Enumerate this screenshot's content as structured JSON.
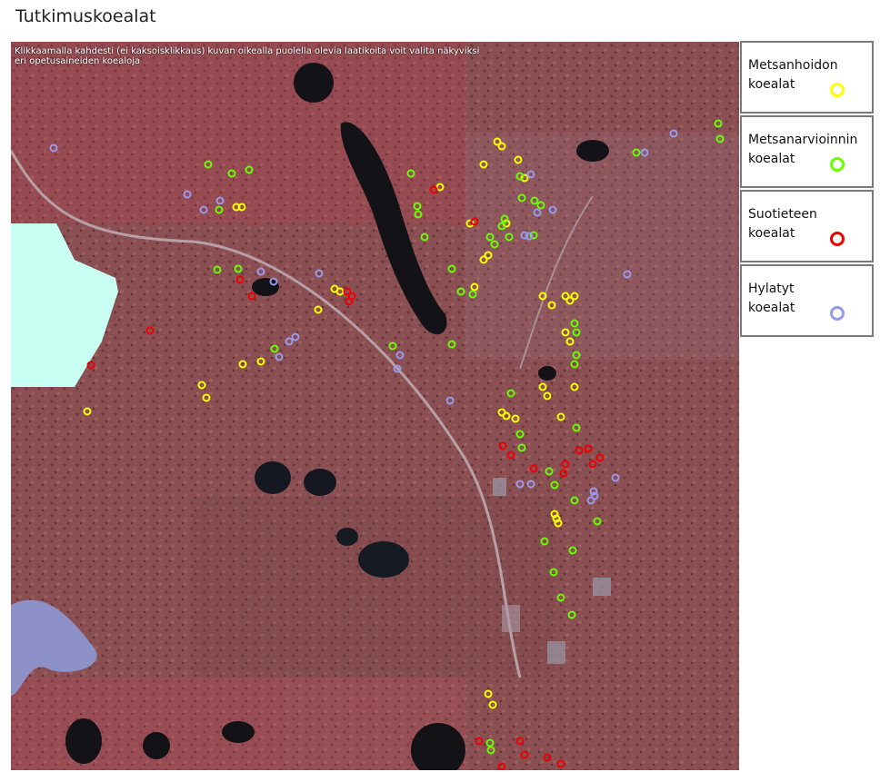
{
  "page": {
    "title": "Tutkimuskoealat"
  },
  "map": {
    "instructions": "Klikkaamalla kahdesti (ei kaksoisklikkaus) kuvan oikealla puolella olevia laatikoita voit valita näkyviksi eri opetusaineiden koealoja",
    "colors": {
      "terrain": "#8a4f52",
      "water": "#121217",
      "nodata": "#c8fff2"
    }
  },
  "legend": [
    {
      "id": "metsanhoito",
      "label": "Metsanhoidon koealat",
      "color": "#ffff00",
      "icon": "circle-marker"
    },
    {
      "id": "metsanarviointi",
      "label": "Metsanarvioinnin koealat",
      "color": "#66ff00",
      "icon": "circle-marker"
    },
    {
      "id": "suotiede",
      "label": "Suotieteen koealat",
      "color": "#ee0000",
      "icon": "circle-marker"
    },
    {
      "id": "hylatyt",
      "label": "Hylatyt koealat",
      "color": "#9999ee",
      "icon": "circle-marker"
    }
  ]
}
